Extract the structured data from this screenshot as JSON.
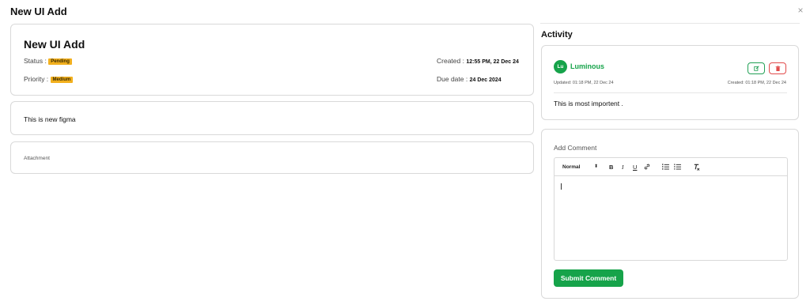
{
  "modal": {
    "title": "New UI Add",
    "close_icon": "close-icon"
  },
  "task": {
    "title": "New UI Add",
    "status_label": "Status :",
    "status_value": "Pending",
    "priority_label": "Priority :",
    "priority_value": "Medium",
    "created_label": "Created :",
    "created_value": "12:55 PM, 22 Dec 24",
    "due_label": "Due date :",
    "due_value": "24 Dec 2024",
    "description": "This is new figma",
    "attachment_label": "Attachment",
    "badge_color": "#f2b01e"
  },
  "activity": {
    "title": "Activity",
    "entry": {
      "avatar_initials": "Lu",
      "user_name": "Luminous",
      "updated": "Updated: 01:18 PM, 22 Dec 24",
      "created": "Created: 01:18 PM, 22 Dec 24",
      "text": "This is most importent .",
      "edit_icon": "edit-icon",
      "delete_icon": "trash-icon"
    }
  },
  "comment": {
    "label": "Add Comment",
    "toolbar": {
      "format_select": "Normal",
      "bold": "B",
      "italic": "I",
      "underline": "U"
    },
    "value": "",
    "submit_label": "Submit Comment"
  },
  "colors": {
    "accent_green": "#16a34a",
    "danger_red": "#e14b4b",
    "badge_amber": "#f2b01e"
  }
}
